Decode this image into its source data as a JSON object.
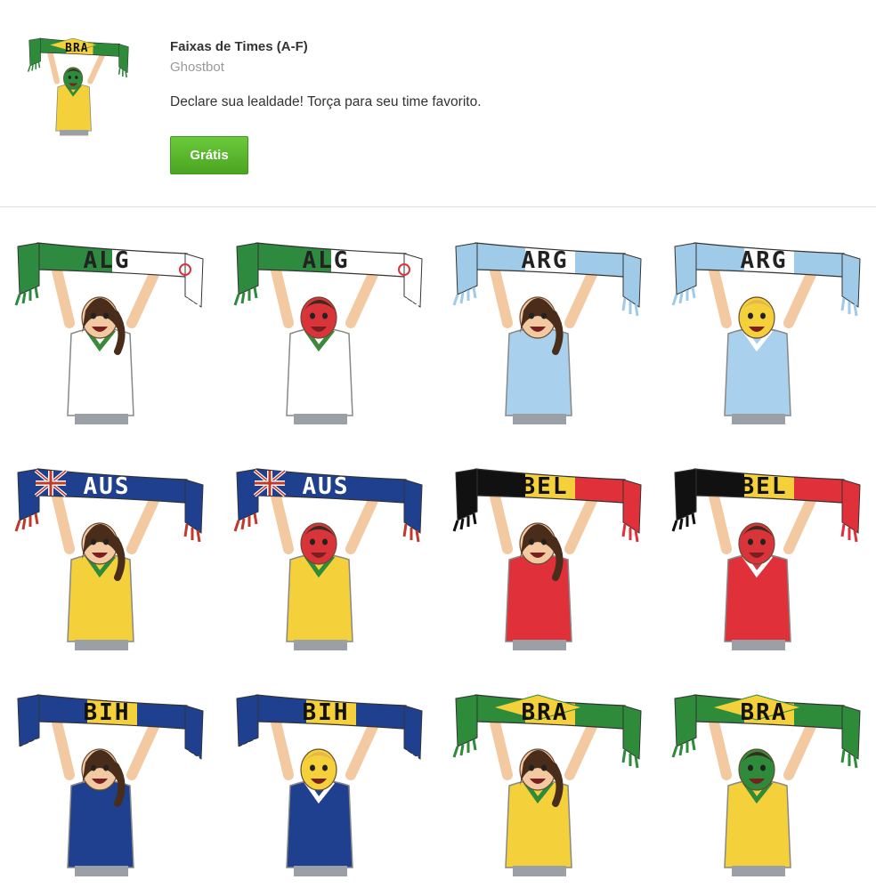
{
  "pack": {
    "title": "Faixas de Times (A-F)",
    "author": "Ghostbot",
    "description": "Declare sua lealdade! Torça para seu time favorito.",
    "price_button": "Grátis",
    "thumbnail_code": "BRA"
  },
  "colors": {
    "button_green": "#56b22b",
    "text_dark": "#333333",
    "text_gray": "#9a9a9a",
    "divider": "#dddddd"
  },
  "stickers": [
    {
      "code": "ALG",
      "gender": "female",
      "face": "plain",
      "shirt": "#ffffff",
      "collar": "#3a8a3a",
      "scarf": "alg"
    },
    {
      "code": "ALG",
      "gender": "male",
      "face": "red",
      "shirt": "#ffffff",
      "collar": "#3a8a3a",
      "scarf": "alg"
    },
    {
      "code": "ARG",
      "gender": "female",
      "face": "plain",
      "shirt": "#a9d0ec",
      "collar": "#a9d0ec",
      "scarf": "arg"
    },
    {
      "code": "ARG",
      "gender": "male",
      "face": "yellow",
      "shirt": "#a9d0ec",
      "collar": "#ffffff",
      "scarf": "arg"
    },
    {
      "code": "AUS",
      "gender": "female",
      "face": "plain",
      "shirt": "#f4d03a",
      "collar": "#2e8b3a",
      "scarf": "aus"
    },
    {
      "code": "AUS",
      "gender": "male",
      "face": "red",
      "shirt": "#f4d03a",
      "collar": "#2e8b3a",
      "scarf": "aus"
    },
    {
      "code": "BEL",
      "gender": "female",
      "face": "plain",
      "shirt": "#e0303a",
      "collar": "#e0303a",
      "scarf": "bel"
    },
    {
      "code": "BEL",
      "gender": "male",
      "face": "red",
      "shirt": "#e0303a",
      "collar": "#ffffff",
      "scarf": "bel"
    },
    {
      "code": "BIH",
      "gender": "female",
      "face": "plain",
      "shirt": "#1f3f8f",
      "collar": "#1f3f8f",
      "scarf": "bih"
    },
    {
      "code": "BIH",
      "gender": "male",
      "face": "yellow",
      "shirt": "#1f3f8f",
      "collar": "#ffffff",
      "scarf": "bih"
    },
    {
      "code": "BRA",
      "gender": "female",
      "face": "plain",
      "shirt": "#f4d03a",
      "collar": "#2e8b3a",
      "scarf": "bra"
    },
    {
      "code": "BRA",
      "gender": "male",
      "face": "green",
      "shirt": "#f4d03a",
      "collar": "#2e8b3a",
      "scarf": "bra"
    }
  ]
}
